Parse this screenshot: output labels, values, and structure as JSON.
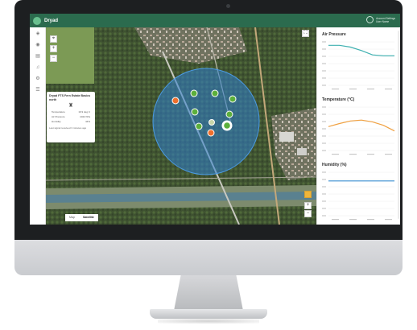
{
  "app": {
    "title": "Dryad",
    "brand_color": "#2b6b4e",
    "user_lines": [
      "Account Settings",
      "User Name"
    ]
  },
  "left_rail": {
    "items": [
      "layers-icon",
      "eye-icon",
      "chart-icon",
      "bell-icon",
      "gear-icon",
      "list-icon"
    ]
  },
  "map": {
    "controls": {
      "fullscreen": "⛶",
      "zoom_in": "+",
      "zoom_out": "−"
    },
    "map_types": [
      "Map",
      "Satellite"
    ],
    "active_map_type": "Satellite",
    "zone_color": "#2f7fd0",
    "sensors": [
      {
        "status": "ok"
      },
      {
        "status": "ok"
      },
      {
        "status": "ok"
      },
      {
        "status": "ok"
      },
      {
        "status": "ok"
      },
      {
        "status": "ok"
      },
      {
        "status": "ok"
      },
      {
        "status": "alert"
      },
      {
        "status": "alert"
      },
      {
        "status": "selected"
      }
    ]
  },
  "popup": {
    "title": "Dryad FTS Fern Estate Basics north",
    "rows": [
      {
        "label": "Temperature",
        "value": "19.9 deg C"
      },
      {
        "label": "Air Pressure",
        "value": "1022 hPa"
      },
      {
        "label": "Humidity",
        "value": "44%"
      }
    ],
    "note": "Last signal received 3 minutes ago"
  },
  "panel": {
    "charts": [
      {
        "title": "Air Pressure",
        "color": "#3eb0b0"
      },
      {
        "title": "Temperature (°C)",
        "color": "#f0a040"
      },
      {
        "title": "Humidity (%)",
        "color": "#3a8fd0"
      }
    ]
  },
  "chart_data": [
    {
      "type": "line",
      "title": "Air Pressure",
      "series": [
        {
          "values": [
            0.92,
            0.92,
            0.88,
            0.8,
            0.7,
            0.68,
            0.68
          ]
        }
      ]
    },
    {
      "type": "line",
      "title": "Temperature (°C)",
      "series": [
        {
          "values": [
            0.55,
            0.62,
            0.68,
            0.7,
            0.66,
            0.58,
            0.45
          ]
        }
      ]
    },
    {
      "type": "line",
      "title": "Humidity (%)",
      "series": [
        {
          "values": [
            0.8,
            0.8,
            0.8,
            0.8,
            0.8,
            0.8,
            0.8
          ]
        }
      ]
    }
  ]
}
